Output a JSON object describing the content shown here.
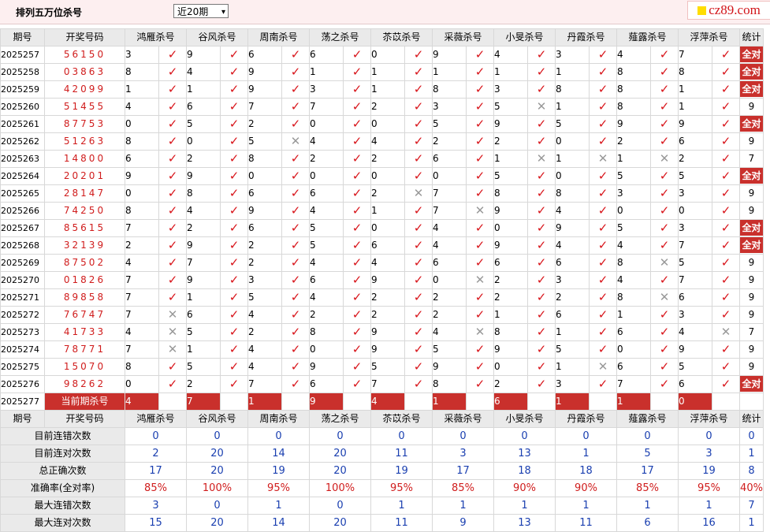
{
  "header": {
    "title": "排列五万位杀号",
    "period_select": "近20期",
    "logo_text": "cz89.com"
  },
  "table": {
    "col_period": "期号",
    "col_number": "开奖号码",
    "col_stat": "统计",
    "experts": [
      "鸿雁杀号",
      "谷风杀号",
      "周南杀号",
      "荡之杀号",
      "苶苡杀号",
      "采薇杀号",
      "小旻杀号",
      "丹霞杀号",
      "薤露杀号",
      "浮萍杀号"
    ],
    "rows": [
      {
        "period": "2025257",
        "number": "56150",
        "kills": [
          3,
          9,
          6,
          6,
          0,
          9,
          4,
          3,
          4,
          7
        ],
        "marks": [
          1,
          1,
          1,
          1,
          1,
          1,
          1,
          1,
          1,
          1
        ],
        "stat": "全对"
      },
      {
        "period": "2025258",
        "number": "03863",
        "kills": [
          8,
          4,
          9,
          1,
          1,
          1,
          1,
          1,
          8,
          8
        ],
        "marks": [
          1,
          1,
          1,
          1,
          1,
          1,
          1,
          1,
          1,
          1
        ],
        "stat": "全对"
      },
      {
        "period": "2025259",
        "number": "42099",
        "kills": [
          1,
          1,
          9,
          3,
          1,
          8,
          3,
          8,
          8,
          1
        ],
        "marks": [
          1,
          1,
          1,
          1,
          1,
          1,
          1,
          1,
          1,
          1
        ],
        "stat": "全对"
      },
      {
        "period": "2025260",
        "number": "51455",
        "kills": [
          4,
          6,
          7,
          7,
          2,
          3,
          5,
          1,
          8,
          1
        ],
        "marks": [
          1,
          1,
          1,
          1,
          1,
          1,
          0,
          1,
          1,
          1
        ],
        "stat": "9"
      },
      {
        "period": "2025261",
        "number": "87753",
        "kills": [
          0,
          5,
          2,
          0,
          0,
          5,
          9,
          5,
          9,
          9
        ],
        "marks": [
          1,
          1,
          1,
          1,
          1,
          1,
          1,
          1,
          1,
          1
        ],
        "stat": "全对"
      },
      {
        "period": "2025262",
        "number": "51263",
        "kills": [
          8,
          0,
          5,
          4,
          4,
          2,
          2,
          0,
          2,
          6
        ],
        "marks": [
          1,
          1,
          0,
          1,
          1,
          1,
          1,
          1,
          1,
          1
        ],
        "stat": "9"
      },
      {
        "period": "2025263",
        "number": "14800",
        "kills": [
          6,
          2,
          8,
          2,
          2,
          6,
          1,
          1,
          1,
          2
        ],
        "marks": [
          1,
          1,
          1,
          1,
          1,
          1,
          0,
          0,
          0,
          1
        ],
        "stat": "7"
      },
      {
        "period": "2025264",
        "number": "20201",
        "kills": [
          9,
          9,
          0,
          0,
          0,
          0,
          5,
          0,
          5,
          5
        ],
        "marks": [
          1,
          1,
          1,
          1,
          1,
          1,
          1,
          1,
          1,
          1
        ],
        "stat": "全对"
      },
      {
        "period": "2025265",
        "number": "28147",
        "kills": [
          0,
          8,
          6,
          6,
          2,
          7,
          8,
          8,
          3,
          3
        ],
        "marks": [
          1,
          1,
          1,
          1,
          0,
          1,
          1,
          1,
          1,
          1
        ],
        "stat": "9"
      },
      {
        "period": "2025266",
        "number": "74250",
        "kills": [
          8,
          4,
          9,
          4,
          1,
          7,
          9,
          4,
          0,
          0
        ],
        "marks": [
          1,
          1,
          1,
          1,
          1,
          0,
          1,
          1,
          1,
          1
        ],
        "stat": "9"
      },
      {
        "period": "2025267",
        "number": "85615",
        "kills": [
          7,
          2,
          6,
          5,
          0,
          4,
          0,
          9,
          5,
          3
        ],
        "marks": [
          1,
          1,
          1,
          1,
          1,
          1,
          1,
          1,
          1,
          1
        ],
        "stat": "全对"
      },
      {
        "period": "2025268",
        "number": "32139",
        "kills": [
          2,
          9,
          2,
          5,
          6,
          4,
          9,
          4,
          4,
          7
        ],
        "marks": [
          1,
          1,
          1,
          1,
          1,
          1,
          1,
          1,
          1,
          1
        ],
        "stat": "全对"
      },
      {
        "period": "2025269",
        "number": "87502",
        "kills": [
          4,
          7,
          2,
          4,
          4,
          6,
          6,
          6,
          8,
          5
        ],
        "marks": [
          1,
          1,
          1,
          1,
          1,
          1,
          1,
          1,
          0,
          1
        ],
        "stat": "9"
      },
      {
        "period": "2025270",
        "number": "01826",
        "kills": [
          7,
          9,
          3,
          6,
          9,
          0,
          2,
          3,
          4,
          7
        ],
        "marks": [
          1,
          1,
          1,
          1,
          1,
          0,
          1,
          1,
          1,
          1
        ],
        "stat": "9"
      },
      {
        "period": "2025271",
        "number": "89858",
        "kills": [
          7,
          1,
          5,
          4,
          2,
          2,
          2,
          2,
          8,
          6
        ],
        "marks": [
          1,
          1,
          1,
          1,
          1,
          1,
          1,
          1,
          0,
          1
        ],
        "stat": "9"
      },
      {
        "period": "2025272",
        "number": "76747",
        "kills": [
          7,
          6,
          4,
          2,
          2,
          2,
          1,
          6,
          1,
          3
        ],
        "marks": [
          0,
          1,
          1,
          1,
          1,
          1,
          1,
          1,
          1,
          1
        ],
        "stat": "9"
      },
      {
        "period": "2025273",
        "number": "41733",
        "kills": [
          4,
          5,
          2,
          8,
          9,
          4,
          8,
          1,
          6,
          4
        ],
        "marks": [
          0,
          1,
          1,
          1,
          1,
          0,
          1,
          1,
          1,
          0
        ],
        "stat": "7"
      },
      {
        "period": "2025274",
        "number": "78771",
        "kills": [
          7,
          1,
          4,
          0,
          9,
          5,
          9,
          5,
          0,
          9
        ],
        "marks": [
          0,
          1,
          1,
          1,
          1,
          1,
          1,
          1,
          1,
          1
        ],
        "stat": "9"
      },
      {
        "period": "2025275",
        "number": "15070",
        "kills": [
          8,
          5,
          4,
          9,
          5,
          9,
          0,
          1,
          6,
          5
        ],
        "marks": [
          1,
          1,
          1,
          1,
          1,
          1,
          1,
          0,
          1,
          1
        ],
        "stat": "9"
      },
      {
        "period": "2025276",
        "number": "98262",
        "kills": [
          0,
          2,
          7,
          6,
          7,
          8,
          2,
          3,
          7,
          6
        ],
        "marks": [
          1,
          1,
          1,
          1,
          1,
          1,
          1,
          1,
          1,
          1
        ],
        "stat": "全对"
      }
    ],
    "current": {
      "period": "2025277",
      "label": "当前期杀号",
      "kills": [
        4,
        7,
        1,
        9,
        4,
        1,
        6,
        1,
        1,
        0
      ]
    },
    "check_mark": "✓",
    "cross_mark": "✕"
  },
  "stats": {
    "rows": [
      {
        "label": "目前连错次数",
        "values": [
          "0",
          "0",
          "0",
          "0",
          "0",
          "0",
          "0",
          "0",
          "0",
          "0",
          "0"
        ]
      },
      {
        "label": "目前连对次数",
        "values": [
          "2",
          "20",
          "14",
          "20",
          "11",
          "3",
          "13",
          "1",
          "5",
          "3",
          "1"
        ]
      },
      {
        "label": "总正确次数",
        "values": [
          "17",
          "20",
          "19",
          "20",
          "19",
          "17",
          "18",
          "18",
          "17",
          "19",
          "8"
        ]
      },
      {
        "label": "准确率(全对率)",
        "values": [
          "85%",
          "100%",
          "95%",
          "100%",
          "95%",
          "85%",
          "90%",
          "90%",
          "85%",
          "95%",
          "40%"
        ]
      },
      {
        "label": "最大连错次数",
        "values": [
          "3",
          "0",
          "1",
          "0",
          "1",
          "1",
          "1",
          "1",
          "1",
          "1",
          "7"
        ]
      },
      {
        "label": "最大连对次数",
        "values": [
          "15",
          "20",
          "14",
          "20",
          "11",
          "9",
          "13",
          "11",
          "6",
          "16",
          "1"
        ]
      }
    ]
  }
}
